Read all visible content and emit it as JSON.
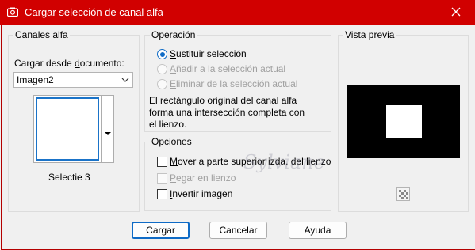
{
  "window": {
    "title": "Cargar selección de canal alfa",
    "accent_color": "#d10000"
  },
  "canales_alfa": {
    "group_label": "Canales alfa",
    "load_from_label_prefix": "Cargar desde ",
    "load_from_label_underlined": "d",
    "load_from_label_suffix": "ocumento:",
    "document_value": "Imagen2",
    "channel_name": "Selectie 3"
  },
  "operacion": {
    "group_label": "Operación",
    "options": [
      {
        "underlined": "S",
        "rest": "ustituir selección",
        "selected": true,
        "enabled": true
      },
      {
        "underlined": "A",
        "rest": "ñadir a la selección actual",
        "selected": false,
        "enabled": false
      },
      {
        "underlined": "E",
        "rest": "liminar de la selección actual",
        "selected": false,
        "enabled": false
      }
    ],
    "info_text": "El rectángulo original del canal alfa forma una intersección completa con el lienzo."
  },
  "opciones": {
    "group_label": "Opciones",
    "checkboxes": [
      {
        "underlined": "M",
        "rest": "over a parte superior izda. del lienzo",
        "checked": false,
        "enabled": true
      },
      {
        "underlined": "P",
        "rest": "egar en lienzo",
        "checked": false,
        "enabled": false
      },
      {
        "underlined": "I",
        "rest": "nvertir imagen",
        "checked": false,
        "enabled": true
      }
    ]
  },
  "vista_previa": {
    "group_label": "Vista previa",
    "icon": "checkerboard-icon"
  },
  "watermark": "Sylviane",
  "buttons": {
    "ok": "Cargar",
    "cancel": "Cancelar",
    "help": "Ayuda"
  }
}
